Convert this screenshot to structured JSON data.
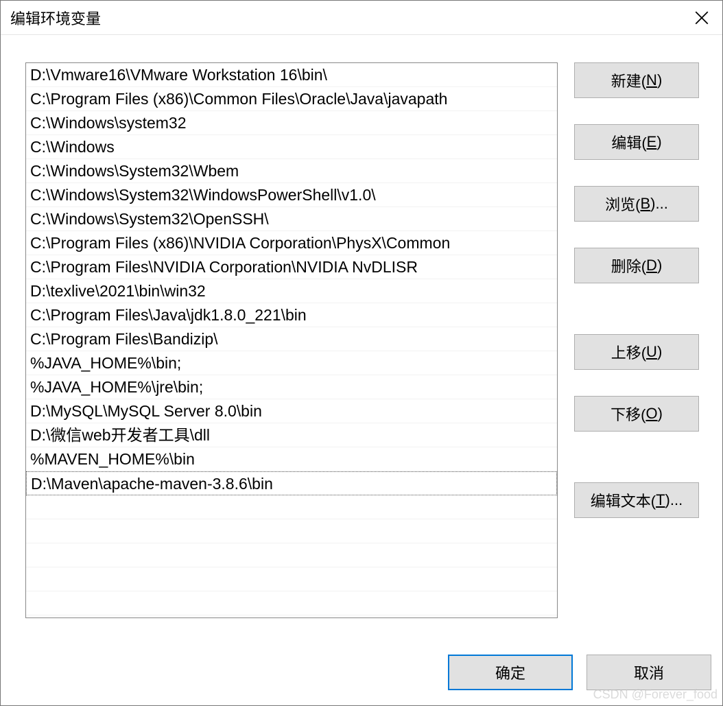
{
  "window": {
    "title": "编辑环境变量"
  },
  "list": {
    "items": [
      "D:\\Vmware16\\VMware Workstation 16\\bin\\",
      "C:\\Program Files (x86)\\Common Files\\Oracle\\Java\\javapath",
      "C:\\Windows\\system32",
      "C:\\Windows",
      "C:\\Windows\\System32\\Wbem",
      "C:\\Windows\\System32\\WindowsPowerShell\\v1.0\\",
      "C:\\Windows\\System32\\OpenSSH\\",
      "C:\\Program Files (x86)\\NVIDIA Corporation\\PhysX\\Common",
      "C:\\Program Files\\NVIDIA Corporation\\NVIDIA NvDLISR",
      "D:\\texlive\\2021\\bin\\win32",
      "C:\\Program Files\\Java\\jdk1.8.0_221\\bin",
      "C:\\Program Files\\Bandizip\\",
      "%JAVA_HOME%\\bin;",
      "%JAVA_HOME%\\jre\\bin;",
      "D:\\MySQL\\MySQL Server 8.0\\bin",
      "D:\\微信web开发者工具\\dll",
      "%MAVEN_HOME%\\bin",
      "D:\\Maven\\apache-maven-3.8.6\\bin"
    ],
    "selected_index": 17
  },
  "buttons": {
    "new_prefix": "新建(",
    "new_key": "N",
    "new_suffix": ")",
    "edit_prefix": "编辑(",
    "edit_key": "E",
    "edit_suffix": ")",
    "browse_prefix": "浏览(",
    "browse_key": "B",
    "browse_suffix": ")...",
    "delete_prefix": "删除(",
    "delete_key": "D",
    "delete_suffix": ")",
    "moveup_prefix": "上移(",
    "moveup_key": "U",
    "moveup_suffix": ")",
    "movedown_prefix": "下移(",
    "movedown_key": "O",
    "movedown_suffix": ")",
    "edittext_prefix": "编辑文本(",
    "edittext_key": "T",
    "edittext_suffix": ")...",
    "ok": "确定",
    "cancel": "取消"
  },
  "watermark": "CSDN @Forever_food"
}
